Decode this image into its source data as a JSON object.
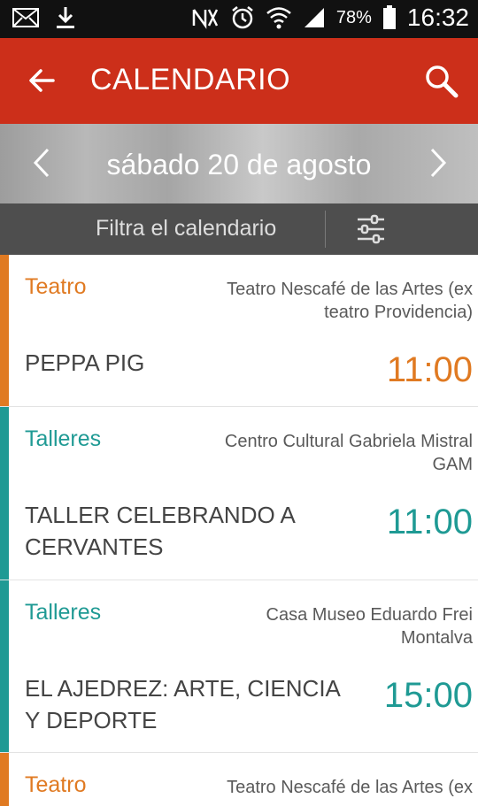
{
  "status_bar": {
    "battery": "78%",
    "time": "16:32",
    "icons": [
      "mail-icon",
      "download-icon",
      "nfc-mute-icon",
      "alarm-icon",
      "wifi-icon",
      "signal-icon",
      "battery-icon"
    ]
  },
  "app_bar": {
    "title": "CALENDARIO",
    "back_icon": "arrow-left-icon",
    "search_icon": "search-icon"
  },
  "date_nav": {
    "label": "sábado 20 de agosto"
  },
  "filter": {
    "label": "Filtra el calendario",
    "icon": "sliders-icon"
  },
  "colors": {
    "app_bar": "#cc2f1a",
    "teatro": "#e07a22",
    "talleres": "#1f9a94"
  },
  "events": [
    {
      "category": "Teatro",
      "venue_line1": "Teatro Nescafé de las Artes (ex",
      "venue_line2": "teatro Providencia)",
      "title_line1": "PEPPA PIG",
      "title_line2": "",
      "time": "11:00",
      "color": "#e07a22"
    },
    {
      "category": "Talleres",
      "venue_line1": "Centro Cultural Gabriela Mistral",
      "venue_line2": "GAM",
      "title_line1": "TALLER CELEBRANDO A",
      "title_line2": "CERVANTES",
      "time": "11:00",
      "color": "#1f9a94"
    },
    {
      "category": "Talleres",
      "venue_line1": "Casa Museo Eduardo Frei",
      "venue_line2": "Montalva",
      "title_line1": "EL AJEDREZ: ARTE, CIENCIA",
      "title_line2": "Y DEPORTE",
      "time": "15:00",
      "color": "#1f9a94"
    },
    {
      "category": "Teatro",
      "venue_line1": "Teatro Nescafé de las Artes (ex",
      "venue_line2": "",
      "title_line1": "",
      "title_line2": "",
      "time": "",
      "color": "#e07a22"
    }
  ]
}
